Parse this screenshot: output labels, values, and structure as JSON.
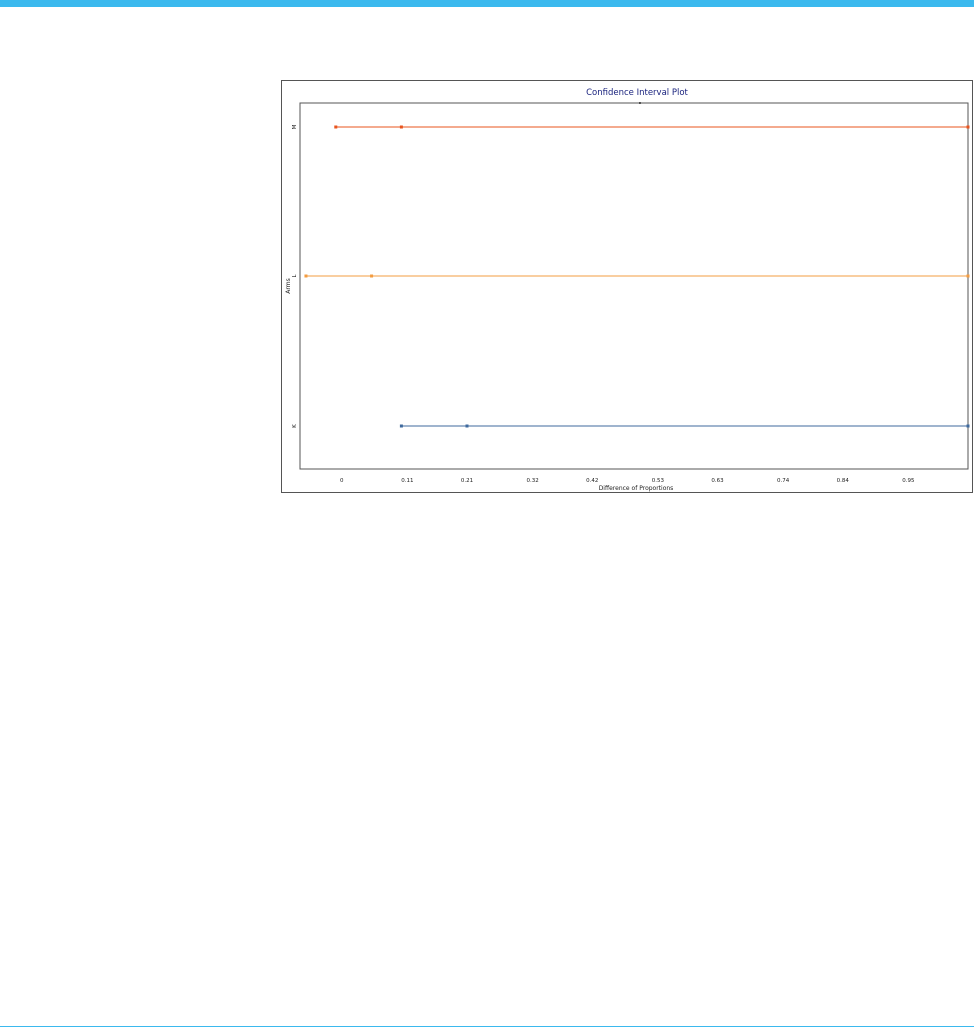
{
  "chart_data": {
    "type": "interval",
    "title": "Confidence Interval Plot",
    "xlabel": "Difference of Proportions",
    "ylabel": "Arms",
    "x_ticks": [
      "0",
      "0.11",
      "0.21",
      "0.32",
      "0.42",
      "0.53",
      "0.63",
      "0.74",
      "0.84",
      "0.95"
    ],
    "xlim": [
      -0.07,
      1.05
    ],
    "y_categories": [
      "M",
      "L",
      "K"
    ],
    "reference_line": 0.5,
    "grid": false,
    "series": [
      {
        "category": "M",
        "lower": -0.01,
        "estimate": 0.1,
        "upper": 1.05,
        "color": "#e8541e"
      },
      {
        "category": "L",
        "lower": -0.06,
        "estimate": 0.05,
        "upper": 1.05,
        "color": "#f39c41"
      },
      {
        "category": "K",
        "lower": 0.1,
        "estimate": 0.21,
        "upper": 1.05,
        "color": "#3f6a9e"
      }
    ]
  },
  "colors": {
    "accent_bar": "#3bb9ee",
    "title": "#1a237e",
    "frame": "#555555"
  }
}
